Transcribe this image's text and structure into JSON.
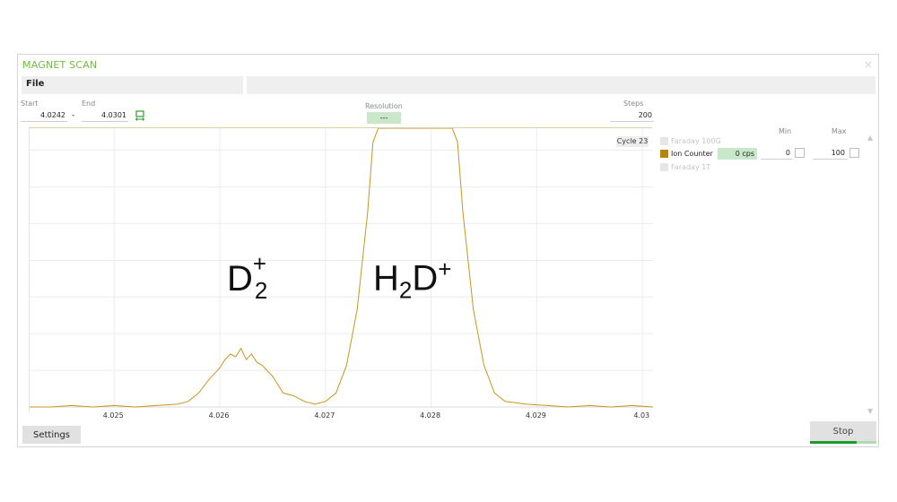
{
  "window": {
    "title": "MAGNET SCAN",
    "close": "×"
  },
  "menu": {
    "file": "File"
  },
  "scan": {
    "start_label": "Start",
    "end_label": "End",
    "start": "4.0242",
    "end": "4.0301",
    "separator": "-",
    "resolution_label": "Resolution",
    "resolution": "---",
    "steps_label": "Steps",
    "steps": "200"
  },
  "cycle": "Cycle 23",
  "annotations": {
    "d2": {
      "base": "D",
      "sub": "2",
      "sup": "+"
    },
    "h2d": {
      "base1": "H",
      "sub": "2",
      "base2": "D",
      "sup": "+"
    }
  },
  "detectors": {
    "min_label": "Min",
    "max_label": "Max",
    "items": [
      {
        "name": "Faraday 100G",
        "active": false,
        "color": "#e6e6e6"
      },
      {
        "name": "Ion Counter",
        "active": true,
        "color": "#b5830f",
        "cps": "0 cps",
        "min": "0",
        "max": "100"
      },
      {
        "name": "Faraday 1T",
        "active": false,
        "color": "#e6e6e6"
      }
    ]
  },
  "buttons": {
    "settings": "Settings",
    "stop": "Stop"
  },
  "stop_progress": 0.7,
  "colors": {
    "title": "#6fbf3a",
    "trace": "#c8961e",
    "accent_green": "#1a9c2a"
  },
  "chart_data": {
    "type": "line",
    "xlim": [
      4.0242,
      4.0301
    ],
    "ylim": [
      0,
      100
    ],
    "xticks": [
      4.025,
      4.026,
      4.027,
      4.028,
      4.029,
      4.03
    ],
    "xtick_labels": [
      "4.025",
      "4.026",
      "4.027",
      "4.028",
      "4.029",
      "4.03"
    ],
    "grid": true,
    "series": [
      {
        "x": [
          4.0242,
          4.0244,
          4.0246,
          4.0248,
          4.025,
          4.0252,
          4.0254,
          4.0256,
          4.0257,
          4.0258,
          4.0259,
          4.026,
          4.02605,
          4.0261,
          4.02615,
          4.0262,
          4.02625,
          4.0263,
          4.02635,
          4.0264,
          4.02645,
          4.0265,
          4.02655,
          4.0266,
          4.0267,
          4.0268,
          4.0269,
          4.027,
          4.0271,
          4.0272,
          4.0273,
          4.0274,
          4.02745,
          4.0275,
          4.0276,
          4.0277,
          4.0278,
          4.0279,
          4.028,
          4.0281,
          4.0282,
          4.02825,
          4.0283,
          4.0284,
          4.0285,
          4.0286,
          4.0287,
          4.0289,
          4.0291,
          4.0293,
          4.0295,
          4.0297,
          4.0299,
          4.0301
        ],
        "y": [
          0,
          0,
          0.5,
          0,
          0.5,
          0,
          0.5,
          1,
          2,
          5,
          10,
          14,
          17,
          19,
          18,
          21,
          17,
          19,
          16,
          15,
          13,
          11,
          8,
          5,
          4,
          2,
          1,
          2,
          5,
          15,
          35,
          70,
          95,
          100,
          100,
          100,
          100,
          100,
          100,
          100,
          100,
          95,
          70,
          35,
          15,
          5,
          2,
          1,
          0.5,
          0,
          0.5,
          0,
          0.5,
          0
        ]
      }
    ]
  }
}
